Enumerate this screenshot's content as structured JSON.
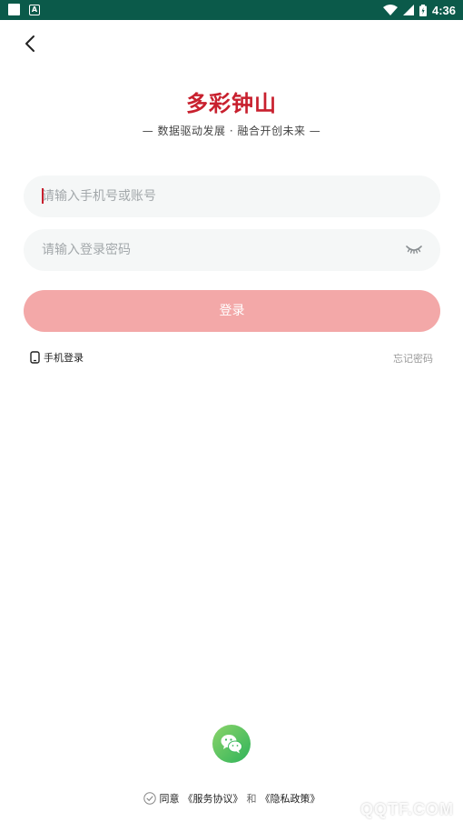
{
  "status_bar": {
    "time": "4:36",
    "left_icons": [
      "square-icon",
      "a-notification-icon"
    ],
    "right_icons": [
      "wifi-icon",
      "signal-icon",
      "battery-icon"
    ],
    "background": "#0b5a4a"
  },
  "header": {
    "app_title": "多彩钟山",
    "slogan": "— 数据驱动发展 · 融合开创未来 —",
    "title_color": "#c8202e"
  },
  "form": {
    "account_placeholder": "请输入手机号或账号",
    "account_value": "",
    "password_placeholder": "请输入登录密码",
    "password_value": "",
    "login_label": "登录",
    "login_color": "#f3a8a8"
  },
  "links": {
    "phone_login": "手机登录",
    "forgot_password": "忘记密码"
  },
  "agreement": {
    "agree": "同意",
    "service": "《服务协议》",
    "and": "和",
    "privacy": "《隐私政策》"
  },
  "watermark": "QQTF.COM"
}
